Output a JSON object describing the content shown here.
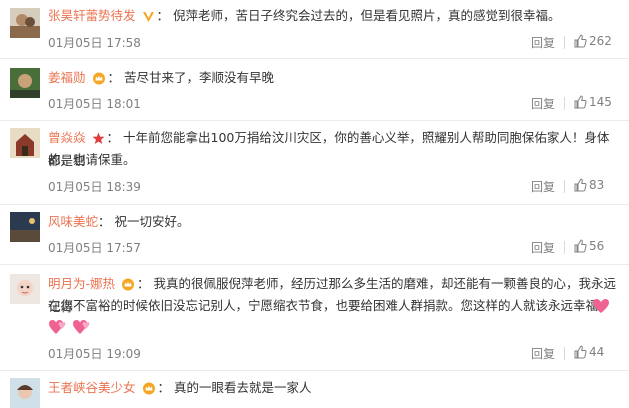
{
  "comments": [
    {
      "name": "张昊轩蕾势待发",
      "text": "倪萍老师，苦日子终究会过去的，但是看见照片，真的感觉到很幸福。",
      "time": "01月05日 17:58",
      "reply": "回复",
      "likes": "262",
      "badge": "vip-v-icon"
    },
    {
      "name": "姜福勋",
      "text": "苦尽甘来了，李顺没有早晚",
      "time": "01月05日 18:01",
      "reply": "回复",
      "likes": "145",
      "badge": "crown-icon"
    },
    {
      "name": "曾焱焱",
      "text_line1": "十年前您能拿出100万捐给汶川灾区，你的善心义举，照耀别人帮助同胞保佑家人！身体都是剔",
      "text_line2": "的，也请保重。",
      "time": "01月05日 18:39",
      "reply": "回复",
      "likes": "83",
      "badge": "star-icon"
    },
    {
      "name": "风味美蛇",
      "text": "祝一切安好。",
      "time": "01月05日 17:57",
      "reply": "回复",
      "likes": "56"
    },
    {
      "name": "明月为-娜热",
      "text_line1": "我真的很佩服倪萍老师，经历过那么多生活的磨难，却还能有一颗善良的心，我永远记得",
      "text_line2": "在您不富裕的时候依旧没忘记别人，宁愿缩衣节食，也要给困难人群捐款。您这样的人就该永远幸福。",
      "time": "01月05日 19:09",
      "reply": "回复",
      "likes": "44",
      "badge": "crown-icon"
    },
    {
      "name": "王者峡谷美少女",
      "text": "真的一眼看去就是一家人",
      "badge": "crown-icon"
    }
  ],
  "colors": {
    "name": "#eb7350",
    "meta": "#808080",
    "text": "#333333",
    "crown": "#f5a623",
    "star": "#e03c3c",
    "heart": "#f06292"
  }
}
